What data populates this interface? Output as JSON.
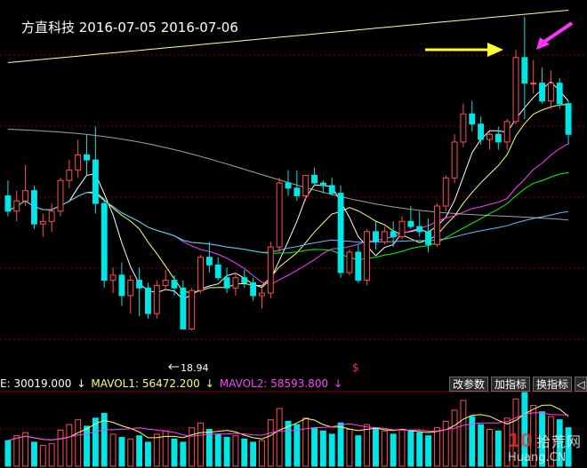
{
  "title": "方直科技 2016-07-05 2016-07-06",
  "low_marker": "18.94",
  "dollar_marker": "$",
  "vol_header": {
    "vol_label": "E: 30019.000",
    "vol_arrow": "↓",
    "mavol1": "MAVOL1: 56472.200",
    "mavol1_arrow": "↓",
    "mavol2": "MAVOL2: 58593.800",
    "mavol2_arrow": "↓"
  },
  "buttons": {
    "gaicanshu": "改参数",
    "jiazhibiao": "加指标",
    "huanzhibiao": "换指标"
  },
  "watermark": {
    "cn": "拾荒网",
    "en": "Huang.CN",
    "num": "10"
  },
  "colors": {
    "up": "#ff5050",
    "down": "#00e5e5",
    "ma5": "#ffffff",
    "ma10": "#ffff66",
    "ma20": "#ff40ff",
    "ma30": "#00ff00",
    "ma60": "#5bc0ff",
    "ma120": "#cccccc",
    "ma250": "#ffff99",
    "grid": "#8b0000",
    "arrow_yellow": "#ffff33",
    "arrow_magenta": "#ff33ff"
  },
  "chart_data": {
    "type": "candlestick",
    "title": "方直科技 2016-07-05 2016-07-06",
    "price_range": [
      17.8,
      31.5
    ],
    "volume_range": [
      0,
      92000
    ],
    "low_annotation": 18.94,
    "grid": true,
    "series": [
      {
        "name": "candles",
        "ohlc": [
          [
            24.2,
            24.8,
            23.4,
            23.6
          ],
          [
            23.6,
            24.4,
            23.2,
            24.0
          ],
          [
            24.0,
            25.4,
            23.8,
            24.4
          ],
          [
            24.4,
            24.6,
            22.9,
            23.1
          ],
          [
            23.1,
            23.5,
            22.6,
            23.2
          ],
          [
            23.2,
            23.9,
            22.8,
            23.6
          ],
          [
            23.6,
            24.9,
            23.4,
            24.8
          ],
          [
            24.8,
            25.6,
            24.5,
            25.2
          ],
          [
            25.2,
            26.4,
            24.9,
            25.8
          ],
          [
            25.8,
            26.6,
            25.0,
            25.6
          ],
          [
            25.6,
            26.9,
            23.5,
            23.9
          ],
          [
            23.9,
            24.1,
            20.6,
            20.9
          ],
          [
            20.9,
            21.4,
            20.4,
            21.1
          ],
          [
            21.1,
            21.6,
            19.9,
            20.3
          ],
          [
            20.3,
            21.1,
            19.6,
            20.9
          ],
          [
            20.9,
            21.4,
            19.5,
            20.6
          ],
          [
            20.6,
            20.8,
            19.4,
            19.6
          ],
          [
            19.6,
            20.9,
            19.4,
            20.7
          ],
          [
            20.7,
            21.3,
            20.5,
            20.9
          ],
          [
            20.9,
            21.1,
            20.3,
            20.6
          ],
          [
            20.6,
            20.9,
            19.0,
            19.0
          ],
          [
            19.0,
            20.6,
            18.94,
            20.5
          ],
          [
            20.5,
            21.9,
            20.4,
            21.8
          ],
          [
            21.8,
            22.4,
            21.2,
            21.5
          ],
          [
            21.5,
            21.8,
            20.9,
            21.0
          ],
          [
            21.0,
            21.4,
            20.4,
            20.6
          ],
          [
            20.6,
            21.2,
            20.3,
            21.0
          ],
          [
            21.0,
            21.3,
            20.6,
            20.8
          ],
          [
            20.8,
            21.0,
            20.1,
            20.3
          ],
          [
            20.3,
            20.6,
            19.8,
            20.4
          ],
          [
            20.4,
            22.4,
            20.2,
            22.2
          ],
          [
            22.2,
            24.9,
            22.0,
            24.7
          ],
          [
            24.7,
            25.2,
            24.2,
            24.5
          ],
          [
            24.5,
            25.2,
            24.0,
            24.2
          ],
          [
            24.2,
            25.0,
            24.0,
            25.0
          ],
          [
            25.0,
            25.3,
            24.6,
            24.7
          ],
          [
            24.7,
            24.8,
            24.3,
            24.6
          ],
          [
            24.6,
            24.9,
            24.2,
            24.3
          ],
          [
            24.3,
            24.6,
            21.0,
            21.2
          ],
          [
            21.2,
            22.1,
            21.1,
            22.0
          ],
          [
            22.0,
            22.3,
            20.8,
            20.9
          ],
          [
            20.9,
            22.9,
            20.7,
            22.8
          ],
          [
            22.8,
            23.2,
            22.1,
            22.4
          ],
          [
            22.4,
            23.0,
            22.3,
            22.8
          ],
          [
            22.8,
            23.2,
            22.2,
            22.6
          ],
          [
            22.6,
            23.4,
            22.5,
            23.2
          ],
          [
            23.2,
            23.8,
            22.9,
            23.0
          ],
          [
            23.0,
            23.6,
            22.6,
            22.8
          ],
          [
            22.8,
            23.3,
            22.0,
            22.3
          ],
          [
            22.3,
            23.9,
            22.2,
            23.8
          ],
          [
            23.8,
            25.0,
            23.6,
            24.9
          ],
          [
            24.9,
            26.6,
            24.7,
            26.3
          ],
          [
            26.3,
            27.8,
            26.1,
            27.4
          ],
          [
            27.4,
            27.9,
            26.7,
            27.0
          ],
          [
            27.0,
            27.3,
            26.2,
            26.4
          ],
          [
            26.4,
            26.7,
            26.0,
            26.6
          ],
          [
            26.6,
            26.9,
            26.0,
            26.3
          ],
          [
            26.3,
            27.2,
            26.0,
            27.1
          ],
          [
            27.1,
            29.9,
            27.0,
            29.6
          ],
          [
            29.6,
            31.2,
            27.2,
            28.6
          ],
          [
            28.6,
            29.5,
            28.2,
            28.6
          ],
          [
            28.6,
            29.2,
            27.8,
            27.9
          ],
          [
            27.9,
            29.1,
            27.6,
            28.6
          ],
          [
            28.6,
            28.8,
            27.6,
            27.8
          ],
          [
            27.8,
            27.9,
            26.2,
            26.6
          ]
        ]
      },
      {
        "name": "volume",
        "values": [
          32000,
          38000,
          42000,
          30000,
          26000,
          28000,
          45000,
          52000,
          58000,
          50000,
          60000,
          66000,
          40000,
          36000,
          34000,
          38000,
          30000,
          40000,
          44000,
          34000,
          30000,
          48000,
          54000,
          46000,
          40000,
          36000,
          38000,
          34000,
          30000,
          32000,
          58000,
          72000,
          56000,
          52000,
          60000,
          48000,
          44000,
          40000,
          54000,
          46000,
          38000,
          52000,
          48000,
          44000,
          40000,
          46000,
          44000,
          42000,
          38000,
          48000,
          56000,
          70000,
          82000,
          62000,
          52000,
          46000,
          44000,
          60000,
          84000,
          92000,
          76000,
          68000,
          62000,
          58000,
          48000
        ]
      }
    ]
  }
}
